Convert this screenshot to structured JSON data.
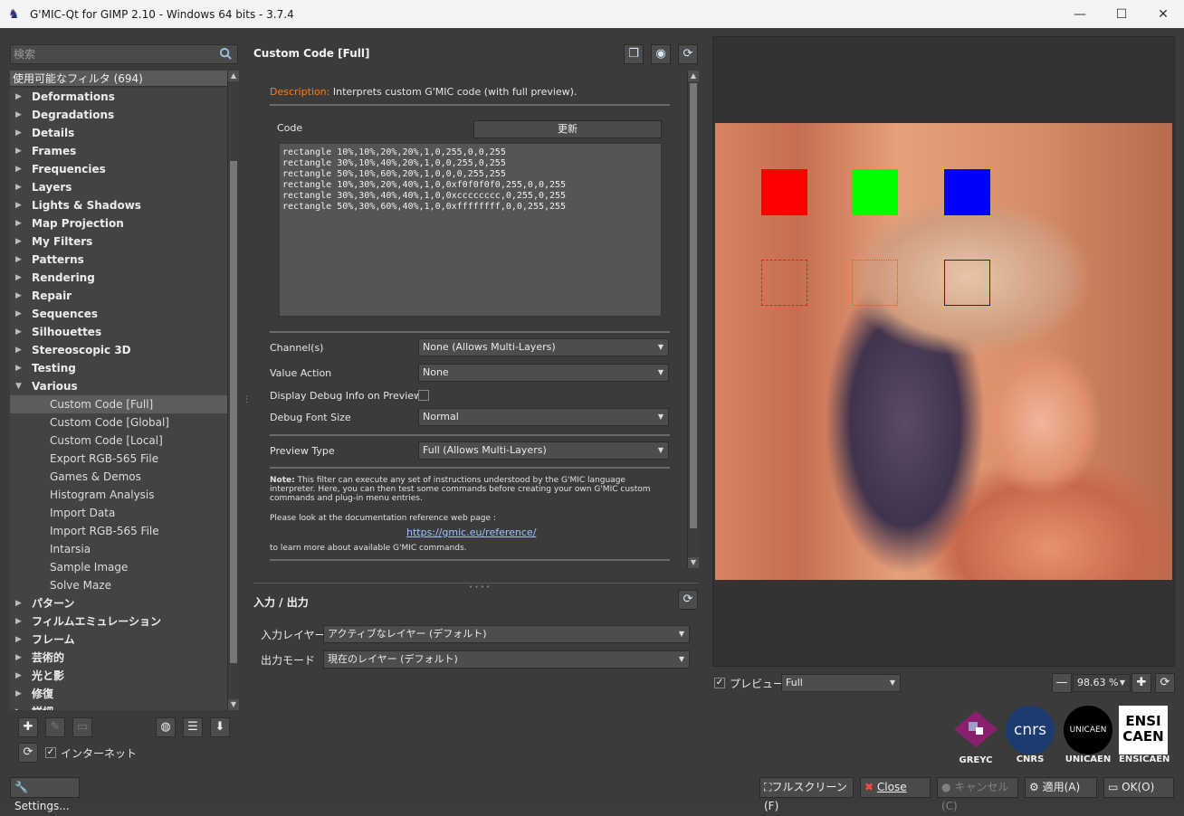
{
  "window": {
    "title": "G'MIC-Qt for GIMP 2.10 - Windows 64 bits - 3.7.4",
    "minimize": "—",
    "maximize": "☐",
    "close": "✕"
  },
  "left": {
    "search_placeholder": "検索",
    "tree_header": "使用可能なフィルタ (694)",
    "categories": [
      "Deformations",
      "Degradations",
      "Details",
      "Frames",
      "Frequencies",
      "Layers",
      "Lights & Shadows",
      "Map Projection",
      "My Filters",
      "Patterns",
      "Rendering",
      "Repair",
      "Sequences",
      "Silhouettes",
      "Stereoscopic 3D",
      "Testing",
      "Various"
    ],
    "various_children": [
      "Custom Code [Full]",
      "Custom Code [Global]",
      "Custom Code [Local]",
      "Export RGB-565 File",
      "Games & Demos",
      "Histogram Analysis",
      "Import Data",
      "Import RGB-565 File",
      "Intarsia",
      "Sample Image",
      "Solve Maze"
    ],
    "more_categories": [
      "パターン",
      "フィルムエミュレーション",
      "フレーム",
      "芸術的",
      "光と影",
      "修復",
      "詳細"
    ],
    "internet_label": "インターネット",
    "settings_label": "Settings..."
  },
  "filter": {
    "title": "Custom Code [Full]",
    "desc_label": "Description:",
    "desc_text": " Interprets custom G'MIC code (with full preview).",
    "code_label": "Code",
    "update_button": "更新",
    "code": "rectangle 10%,10%,20%,20%,1,0,255,0,0,255\nrectangle 30%,10%,40%,20%,1,0,0,255,0,255\nrectangle 50%,10%,60%,20%,1,0,0,0,255,255\nrectangle 10%,30%,20%,40%,1,0,0xf0f0f0f0,255,0,0,255\nrectangle 30%,30%,40%,40%,1,0,0xcccccccc,0,255,0,255\nrectangle 50%,30%,60%,40%,1,0,0xffffffff,0,0,255,255",
    "channels_label": "Channel(s)",
    "channels_value": "None (Allows Multi-Layers)",
    "value_action_label": "Value Action",
    "value_action_value": "None",
    "debug_label": "Display Debug Info on Preview",
    "font_size_label": "Debug Font Size",
    "font_size_value": "Normal",
    "preview_type_label": "Preview Type",
    "preview_type_value": "Full (Allows Multi-Layers)",
    "note_bold": "Note:",
    "note_text": " This filter can execute any set of instructions understood by the G'MIC language interpreter. Here, you can then test some commands before creating your own G'MIC custom commands and plug-in menu entries.",
    "doc_line": "Please look at the documentation reference web page :",
    "doc_link": "https://gmic.eu/reference/",
    "learn_line": "to learn more about available G'MIC commands."
  },
  "io": {
    "title": "入力 / 出力",
    "input_label": "入力レイヤー",
    "input_value": "アクティブなレイヤー (デフォルト)",
    "output_label": "出力モード",
    "output_value": "現在のレイヤー (デフォルト)"
  },
  "preview": {
    "label": "プレビュー",
    "mode": "Full",
    "zoom": "98.63 %"
  },
  "logos": [
    "GREYC",
    "CNRS",
    "UNICAEN",
    "ENSICAEN"
  ],
  "logo_marks": {
    "cnrs": "cnrs",
    "unicaen": "UNICAEN",
    "ensicaen": "ENSI CAEN"
  },
  "buttons": {
    "fullscreen": "フルスクリーン(F)",
    "close": "Close",
    "cancel": "キャンセル(C)",
    "apply": "適用(A)",
    "ok": "OK(O)"
  },
  "colors": {
    "accent_orange": "#ff7a1a",
    "red": "#ff0000",
    "green": "#00ff00",
    "blue": "#0000ff"
  }
}
